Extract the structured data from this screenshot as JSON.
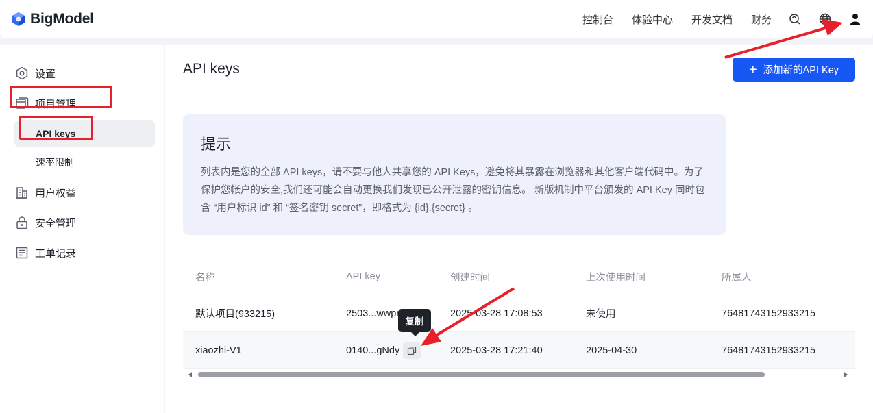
{
  "brand": {
    "name": "BigModel"
  },
  "topnav": {
    "items": [
      "控制台",
      "体验中心",
      "开发文档",
      "财务"
    ],
    "icons": [
      "support-icon",
      "globe-icon",
      "user-icon"
    ]
  },
  "sidebar": {
    "items": [
      {
        "label": "设置",
        "icon": "settings-icon"
      },
      {
        "label": "项目管理",
        "icon": "project-icon"
      },
      {
        "label": "用户权益",
        "icon": "benefits-icon"
      },
      {
        "label": "安全管理",
        "icon": "lock-icon"
      },
      {
        "label": "工单记录",
        "icon": "ticket-icon"
      }
    ],
    "sub_items": [
      "API keys",
      "速率限制"
    ]
  },
  "main": {
    "title": "API keys",
    "add_button": "添加新的API Key",
    "tip": {
      "title": "提示",
      "text": "列表内是您的全部 API keys，请不要与他人共享您的 API Keys，避免将其暴露在浏览器和其他客户端代码中。为了保护您帐户的安全,我们还可能会自动更换我们发现已公开泄露的密钥信息。 新版机制中平台颁发的 API Key 同时包含 “用户标识 id” 和 “签名密钥 secret”，即格式为 {id}.{secret} 。"
    },
    "table": {
      "headers": [
        "名称",
        "API key",
        "创建时间",
        "上次使用时间",
        "所属人"
      ],
      "rows": [
        [
          "默认项目(933215)",
          "2503...wwpr",
          "2025-03-28 17:08:53",
          "未使用",
          "76481743152933215"
        ],
        [
          "xiaozhi-V1",
          "0140...gNdy",
          "2025-03-28 17:21:40",
          "2025-04-30",
          "76481743152933215"
        ]
      ]
    },
    "tooltip": "复制",
    "scroll_position": 0
  },
  "colors": {
    "accent": "#1657f5",
    "annotation_red": "#e8202a",
    "tip_background": "#eef1fb"
  }
}
